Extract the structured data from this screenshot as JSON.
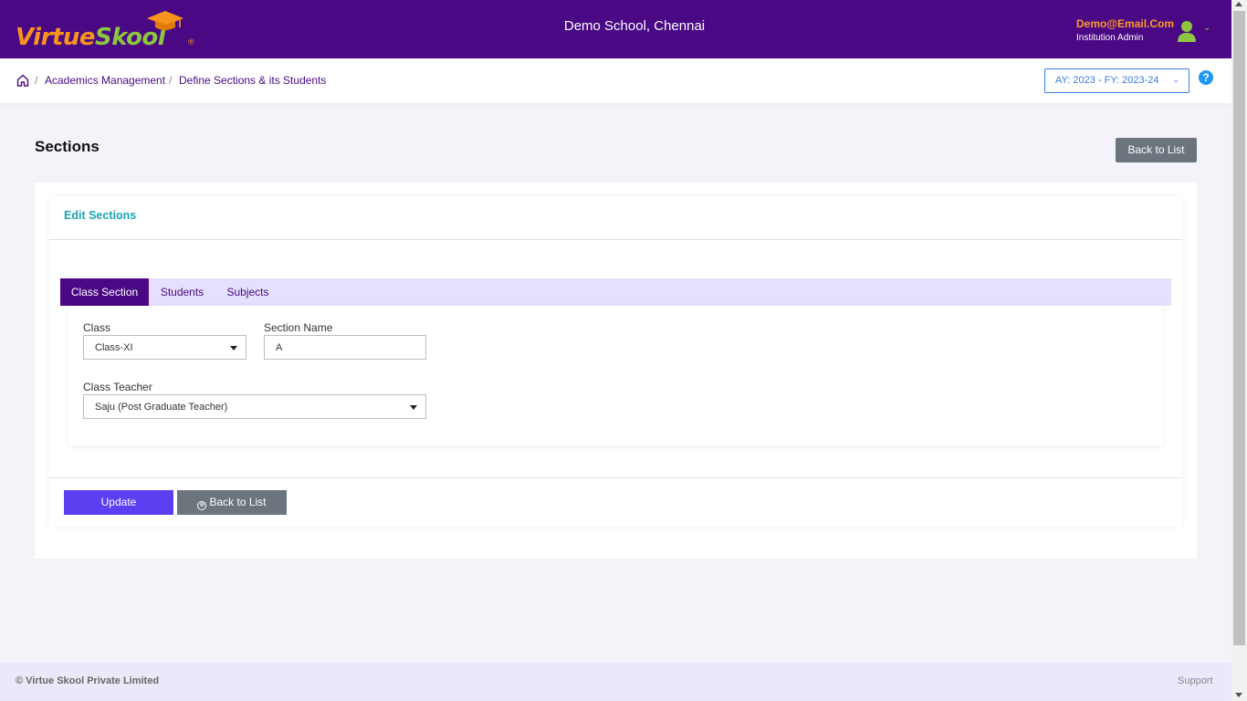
{
  "header": {
    "logo": {
      "part1": "Virtue",
      "part2": "Skool",
      "reg": "®"
    },
    "school_name": "Demo School, Chennai",
    "user_email": "Demo@Email.Com",
    "user_role": "Institution Admin",
    "avatar_icon": "user-icon",
    "chevron_icon": "chevron-down-icon"
  },
  "breadcrumb": {
    "home_icon": "home-icon",
    "sep1": "/",
    "item1": "Academics Management",
    "sep2": "/",
    "item2": "Define Sections & its Students"
  },
  "year_selector": {
    "label": "AY: 2023 - FY: 2023-24",
    "chevron": "⌄"
  },
  "help": {
    "glyph": "?"
  },
  "page": {
    "title": "Sections",
    "back_to_list_top": "Back to List"
  },
  "card": {
    "title": "Edit Sections"
  },
  "tabs": [
    {
      "label": "Class Section",
      "active": true
    },
    {
      "label": "Students",
      "active": false
    },
    {
      "label": "Subjects",
      "active": false
    }
  ],
  "form": {
    "class": {
      "label": "Class",
      "value": "Class-XI"
    },
    "section_name": {
      "label": "Section Name",
      "value": "A"
    },
    "class_teacher": {
      "label": "Class Teacher",
      "value": "Saju (Post Graduate Teacher)"
    }
  },
  "actions": {
    "update": "Update",
    "back_icon": "⊕",
    "back_to_list": "Back to List"
  },
  "footer": {
    "copyright": "© Virtue Skool Private Limited",
    "support": "Support"
  },
  "colors": {
    "brand_purple": "#4a0885",
    "accent_orange": "#f7941d",
    "accent_green": "#8dc63f",
    "primary_button": "#5b3ff1",
    "secondary_button": "#6c757d",
    "card_title": "#1ea2b3"
  }
}
